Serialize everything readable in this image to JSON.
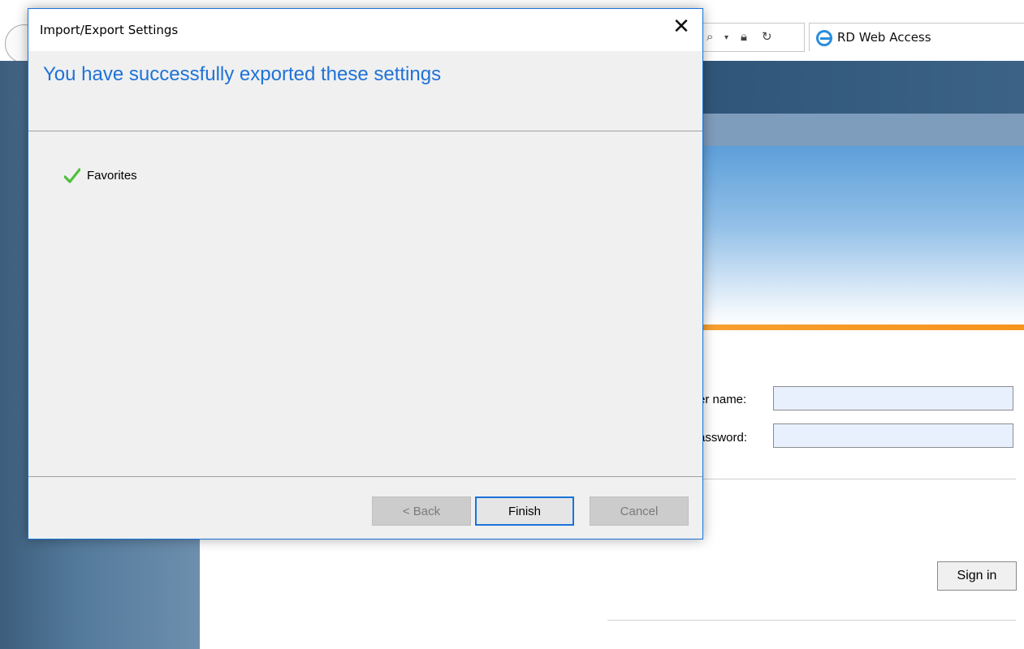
{
  "browser": {
    "tab_title": "RD Web Access",
    "address_icons": [
      "search-icon",
      "dropdown-arrow-icon",
      "lock-icon",
      "refresh-icon"
    ]
  },
  "login": {
    "username_label": "er name:",
    "password_label": "assword:",
    "sign_in_label": "Sign in"
  },
  "dialog": {
    "title": "Import/Export Settings",
    "close_glyph": "✕",
    "heading": "You have successfully exported these settings",
    "items": [
      {
        "label": "Favorites",
        "status_icon": "checkmark-icon",
        "status_color": "#4fbf3a"
      }
    ],
    "buttons": {
      "back": "< Back",
      "finish": "Finish",
      "cancel": "Cancel"
    },
    "accent_color": "#1e72d8"
  }
}
